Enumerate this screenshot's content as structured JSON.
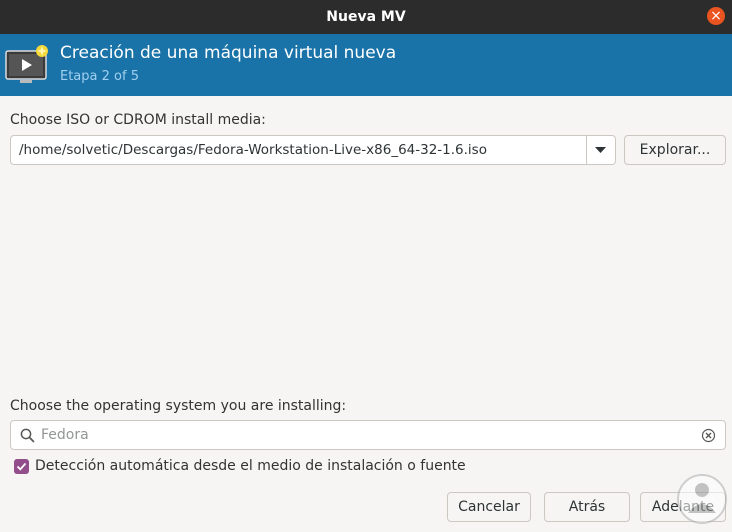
{
  "window": {
    "title": "Nueva MV"
  },
  "header": {
    "title": "Creación de una máquina virtual nueva",
    "step": "Etapa 2 of 5"
  },
  "install_media": {
    "label": "Choose ISO or CDROM install media:",
    "selected_path": "/home/solvetic/Descargas/Fedora-Workstation-Live-x86_64-32-1.6.iso",
    "browse_label": "Explorar..."
  },
  "os_selection": {
    "label": "Choose the operating system you are installing:",
    "search_value": "",
    "search_placeholder": "Fedora"
  },
  "auto_detect": {
    "label": "Detección automática desde el medio de instalación o fuente",
    "checked": true
  },
  "buttons": {
    "cancel": "Cancelar",
    "back": "Atrás",
    "forward": "Adelante"
  },
  "colors": {
    "header_bg": "#1a73a8",
    "titlebar_bg": "#2c2c2c",
    "close_button": "#e95420",
    "checkbox_accent": "#924d8b"
  },
  "icons": {
    "header": "virtual-machine-icon",
    "combo": "chevron-down-icon",
    "search": "search-icon",
    "clear": "clear-icon",
    "close": "close-icon",
    "check": "check-icon"
  }
}
